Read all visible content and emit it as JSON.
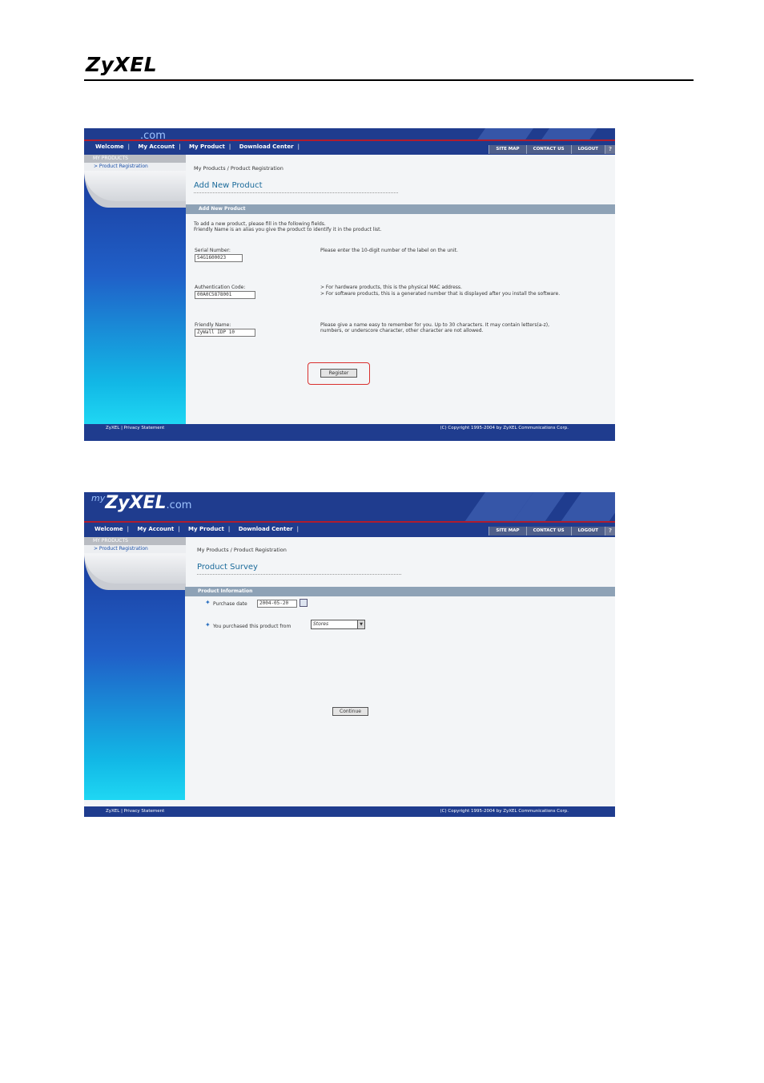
{
  "doc": {
    "logo": "ZyXEL"
  },
  "shot1": {
    "nav": [
      "Welcome",
      "My Account",
      "My Product",
      "Download Center"
    ],
    "tools": [
      "SITE MAP",
      "CONTACT US",
      "LOGOUT",
      "?"
    ],
    "sidebar": {
      "heading": "MY PRODUCTS",
      "item": "> Product Registration"
    },
    "breadcrumb": "My Products / Product Registration",
    "title": "Add New Product",
    "section": "Add New Product",
    "intro": [
      "To add a new product, please fill in the following fields.",
      "Friendly Name is an alias you give the product to identify it in the product list."
    ],
    "serial": {
      "label": "Serial Number:",
      "value": "S4G1600023",
      "hint": "Please enter the 10-digit number of the label on the unit."
    },
    "auth": {
      "label": "Authentication Code:",
      "value": "00A0C5878001",
      "hint1": "> For hardware products, this is the physical MAC address.",
      "hint2": "> For software products, this is a generated number that is displayed after you install the software."
    },
    "friendly": {
      "label": "Friendly Name:",
      "value": "ZyWall IDP 10",
      "hint1": "Please give a name easy to remember for you. Up to 30 characters. It may contain letters(a-z),",
      "hint2": "numbers, or underscore character, other character are not allowed."
    },
    "register": "Register",
    "footer_left": "ZyXEL | Privacy Statement",
    "footer_right": "(C) Copyright 1995-2004 by ZyXEL Communications Corp."
  },
  "shot2": {
    "brand": {
      "my": "my",
      "name": "ZyXEL",
      "com": ".com"
    },
    "nav": [
      "Welcome",
      "My Account",
      "My Product",
      "Download Center"
    ],
    "tools": [
      "SITE MAP",
      "CONTACT US",
      "LOGOUT",
      "?"
    ],
    "sidebar": {
      "heading": "MY PRODUCTS",
      "item": "> Product Registration"
    },
    "breadcrumb": "My Products / Product Registration",
    "title": "Product Survey",
    "section": "Product Information",
    "purchase_label": "Purchase date",
    "purchase_value": "2004-05-20",
    "from_label": "You purchased this product from",
    "from_value": "Stores",
    "continue": "Continue",
    "footer_left": "ZyXEL | Privacy Statement",
    "footer_right": "(C) Copyright 1995-2004 by ZyXEL Communications Corp."
  }
}
